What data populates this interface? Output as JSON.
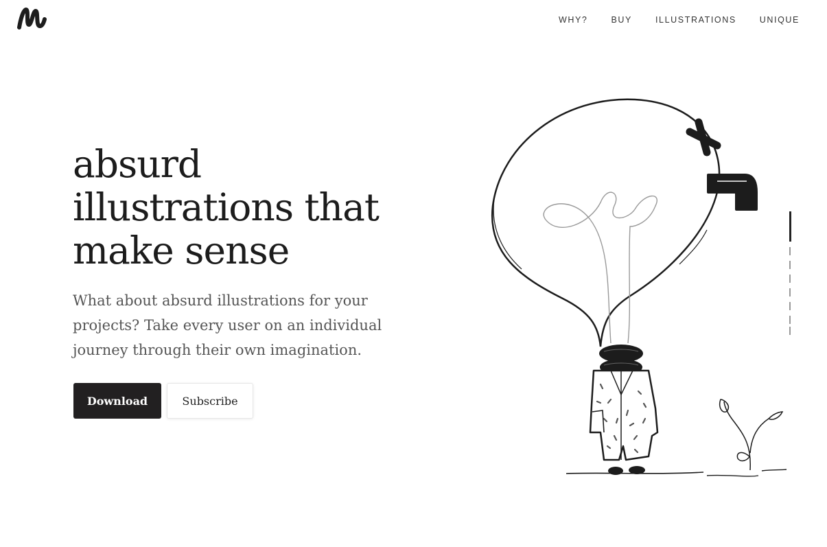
{
  "nav": {
    "items": [
      "WHY?",
      "BUY",
      "ILLUSTRATIONS",
      "UNIQUE"
    ]
  },
  "hero": {
    "title": "absurd illustrations that make sense",
    "description": "What about absurd illustrations for your projects? Take every user on an individual journey through their own imagination.",
    "download_label": "Download",
    "subscribe_label": "Subscribe"
  },
  "scroll_indicator": {
    "current": 1,
    "total": 4
  },
  "colors": {
    "primary_button": "#222021",
    "text": "#1c1c1c",
    "muted_text": "#555555"
  }
}
